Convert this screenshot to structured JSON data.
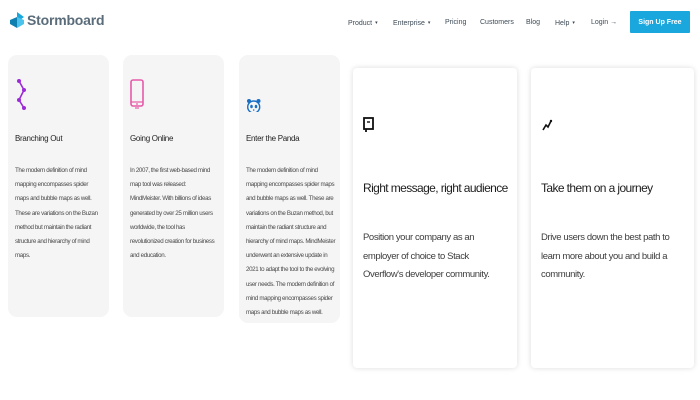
{
  "brand": {
    "name": "Stormboard",
    "color": "#1aa7de"
  },
  "nav": {
    "items": [
      {
        "label": "Product",
        "caret": "▾"
      },
      {
        "label": "Enterprise",
        "caret": "▾"
      },
      {
        "label": "Pricing",
        "caret": ""
      },
      {
        "label": "Customers",
        "caret": ""
      },
      {
        "label": "Blog",
        "caret": ""
      },
      {
        "label": "Help",
        "caret": "▾"
      },
      {
        "label": "Login →",
        "caret": ""
      }
    ],
    "cta": "Sign Up Free"
  },
  "features": [
    {
      "icon": "branch-icon",
      "icon_color": "#9b2bd6",
      "title": "Branching Out",
      "body": "The modern definition of mind mapping encompasses spider maps and bubble maps as well. These are variations on the Buzan method but maintain the radiant structure and hierarchy of mind maps."
    },
    {
      "icon": "tablet-icon",
      "icon_color": "#e75aa8",
      "title": "Going Online",
      "body": "In 2007, the first web-based mind map tool was released: MindMeister. With billions of ideas generated by over 25 million users worldwide, the tool has revolutionized creation for business and education."
    },
    {
      "icon": "panda-icon",
      "icon_color": "#1a6fc4",
      "title": "Enter the Panda",
      "body": "The modern definition of mind mapping encompasses spider maps and bubble maps as well. These are variations on the Buzan method, but maintain the radiant structure and hierarchy of mind maps. MindMeister underwent an extensive update in 2021 to adapt the tool to the evolving user needs. The modern definition of mind mapping encompasses spider maps and bubble maps as well."
    }
  ],
  "cards": [
    {
      "icon": "document-icon",
      "title": "Right message, right audience",
      "body": "Position your company as an employer of choice to Stack Overflow's developer community."
    },
    {
      "icon": "route-icon",
      "title": "Take them on a journey",
      "body": "Drive users down the best path to learn more about you and build a community."
    }
  ]
}
